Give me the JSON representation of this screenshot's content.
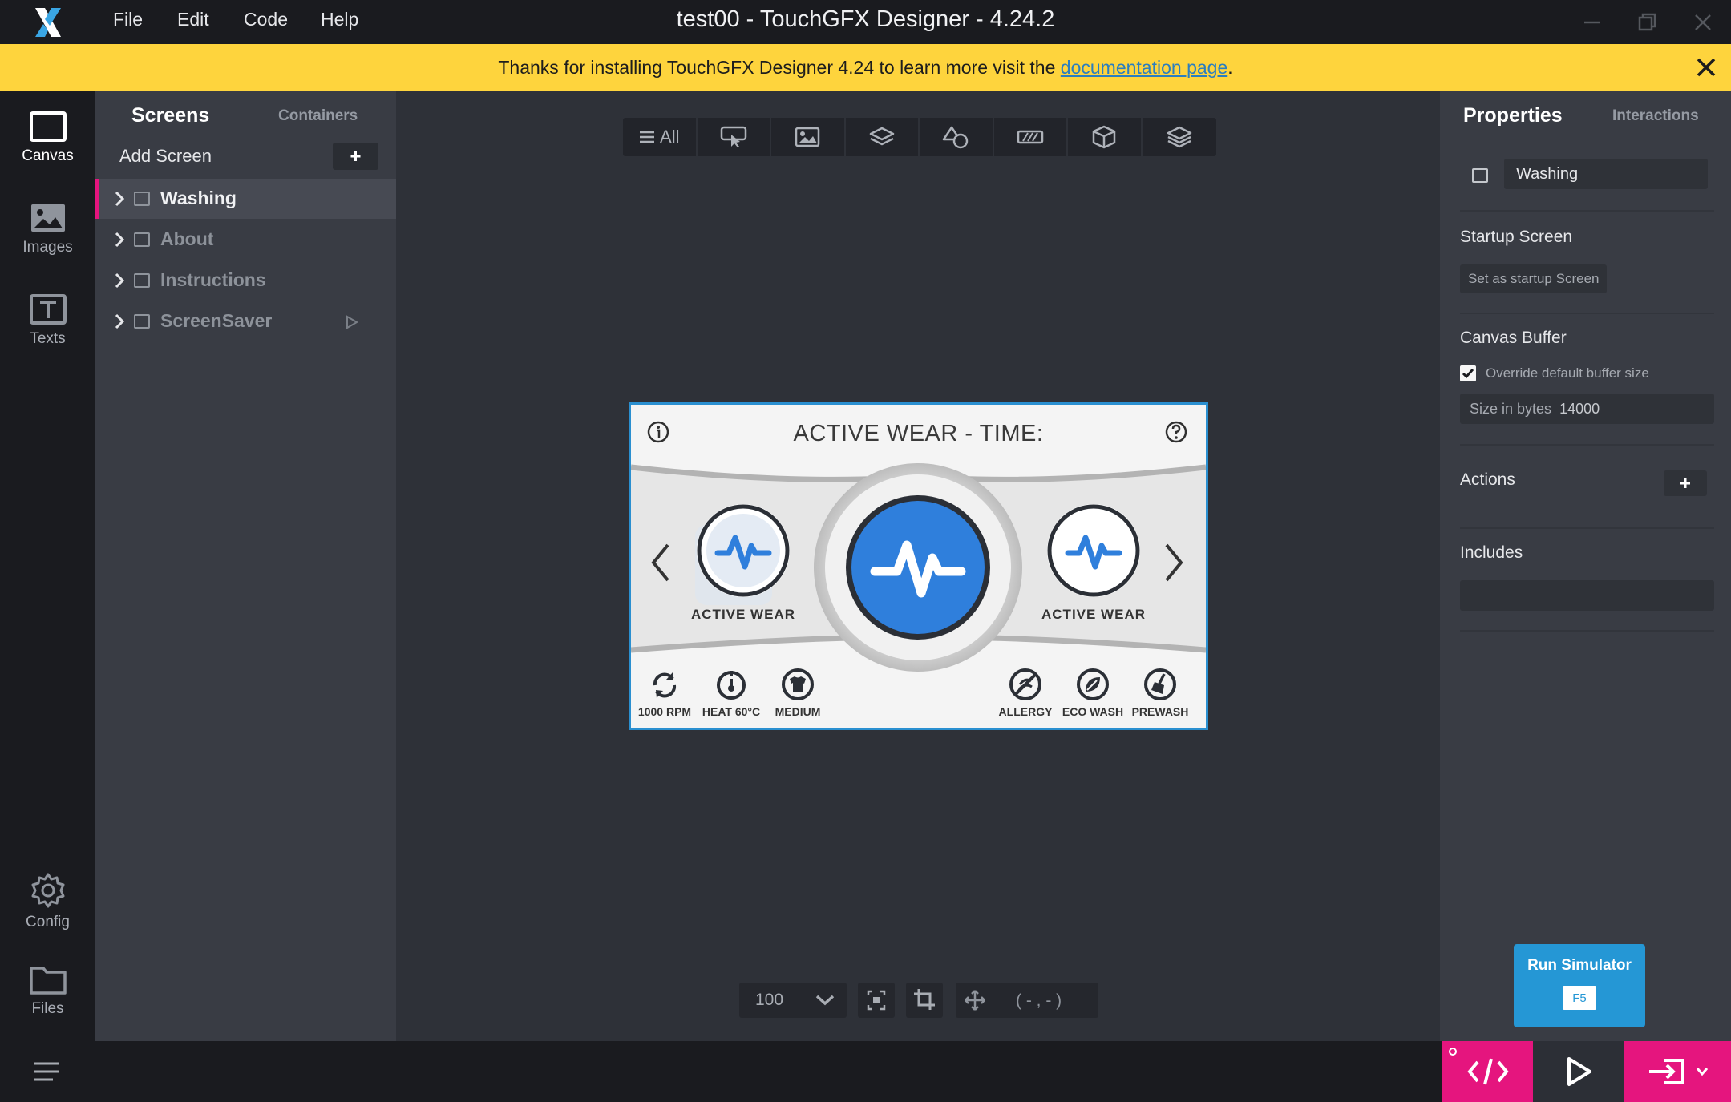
{
  "app": {
    "title": "test00 - TouchGFX Designer - 4.24.2",
    "menu": [
      "File",
      "Edit",
      "Code",
      "Help"
    ]
  },
  "banner": {
    "text_before": "Thanks for installing TouchGFX Designer 4.24 to learn more visit the ",
    "link_text": "documentation page",
    "text_after": "."
  },
  "rail": {
    "items": [
      {
        "label": "Canvas",
        "icon": "canvas-icon"
      },
      {
        "label": "Images",
        "icon": "image-icon"
      },
      {
        "label": "Texts",
        "icon": "text-icon"
      },
      {
        "label": "Config",
        "icon": "gear-icon"
      },
      {
        "label": "Files",
        "icon": "folder-icon"
      }
    ]
  },
  "screens_panel": {
    "tabs": [
      "Screens",
      "Containers"
    ],
    "add_screen_label": "Add Screen",
    "screens": [
      {
        "label": "Washing",
        "selected": true
      },
      {
        "label": "About",
        "selected": false
      },
      {
        "label": "Instructions",
        "selected": false
      },
      {
        "label": "ScreenSaver",
        "selected": false
      }
    ]
  },
  "widget_toolbar": {
    "all_label": "All",
    "filters": [
      "interaction-icon",
      "image-widget-icon",
      "layers-icon",
      "shapes-icon",
      "progress-icon",
      "3d-box-icon",
      "stack-icon"
    ]
  },
  "design": {
    "title": "ACTIVE WEAR   -   TIME:",
    "left_program_label": "ACTIVE WEAR",
    "right_program_label": "ACTIVE WEAR",
    "options": [
      "1000 RPM",
      "HEAT 60°C",
      "MEDIUM",
      "ALLERGY",
      "ECO WASH",
      "PREWASH"
    ],
    "accent": "#2f7fdc"
  },
  "canvas_toolbar": {
    "zoom": "100",
    "coordinates": "( - , - )"
  },
  "properties": {
    "tabs": [
      "Properties",
      "Interactions"
    ],
    "name_value": "Washing",
    "startup_heading": "Startup Screen",
    "startup_button": "Set as startup Screen",
    "buffer_heading": "Canvas Buffer",
    "override_label": "Override default buffer size",
    "override_checked": true,
    "size_label": "Size in bytes",
    "size_value": "14000",
    "actions_heading": "Actions",
    "includes_heading": "Includes"
  },
  "run_simulator": {
    "label": "Run Simulator",
    "shortcut": "F5"
  },
  "colors": {
    "accent_pink": "#e5157e",
    "banner_yellow": "#fed43d",
    "simulator_blue": "#2597d5"
  }
}
